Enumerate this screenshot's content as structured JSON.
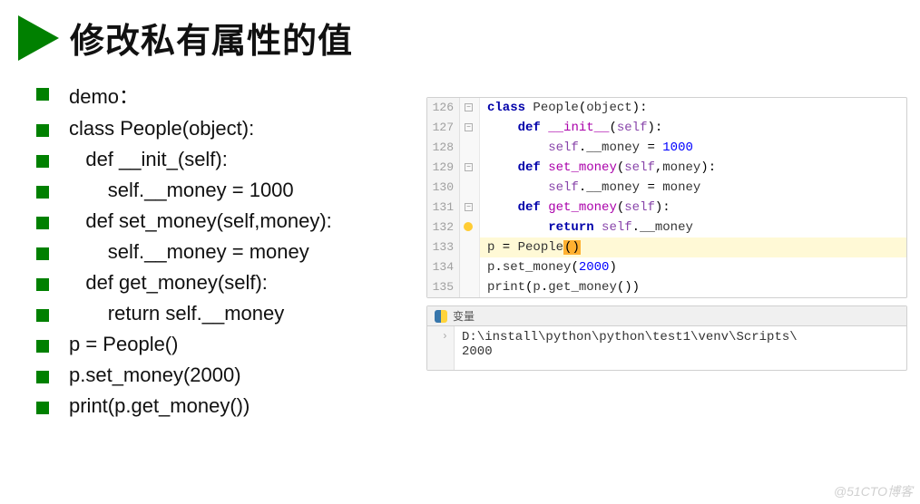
{
  "title": "修改私有属性的值",
  "bullets": [
    "demo：",
    "class People(object):",
    "   def __init_(self):",
    "       self.__money = 1000",
    "   def set_money(self,money):",
    "       self.__money = money",
    "   def get_money(self):",
    "       return self.__money",
    "p = People()",
    "p.set_money(2000)",
    "print(p.get_money())"
  ],
  "code": {
    "lines": [
      {
        "n": "126",
        "collapse": true
      },
      {
        "n": "127",
        "collapse": true
      },
      {
        "n": "128"
      },
      {
        "n": "129",
        "collapse": true
      },
      {
        "n": "130"
      },
      {
        "n": "131",
        "collapse": true
      },
      {
        "n": "132",
        "bulb": true
      },
      {
        "n": "133"
      },
      {
        "n": "134"
      },
      {
        "n": "135"
      }
    ],
    "tokens": {
      "class": "class",
      "def": "def",
      "return": "return",
      "People": "People",
      "object": "object",
      "init": "__init__",
      "self": "self",
      "set_money": "set_money",
      "get_money": "get_money",
      "money_attr": "__money",
      "money_param": "money",
      "thousand": "1000",
      "twothou": "2000",
      "p": "p",
      "print": "print"
    }
  },
  "terminal": {
    "tab": "变量",
    "path": "D:\\install\\python\\python\\test1\\venv\\Scripts\\",
    "output": "2000",
    "arrow": "›"
  },
  "watermark": "@51CTO博客"
}
